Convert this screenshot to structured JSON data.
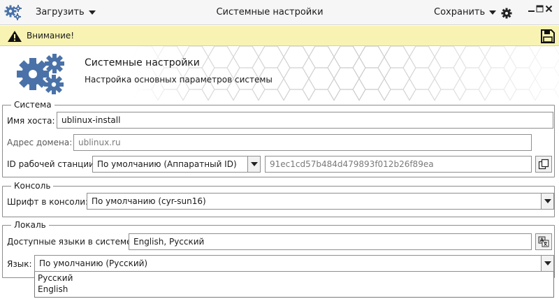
{
  "titlebar": {
    "load_label": "Загрузить",
    "title": "Системные настройки",
    "save_label": "Сохранить"
  },
  "warning": {
    "text": "Внимание!"
  },
  "banner": {
    "title": "Системные настройки",
    "subtitle": "Настройка основных параметров системы"
  },
  "system": {
    "legend": "Система",
    "hostname_label": "Имя хоста:",
    "hostname_value": "ublinux-install",
    "domain_label": "Адрес домена:",
    "domain_placeholder": "ublinux.ru",
    "machine_id_label": "ID рабочей станции:",
    "machine_id_mode": "По умолчанию (Аппаратный ID)",
    "machine_id_value": "91ec1cd57b484d479893f012b26f89ea"
  },
  "console": {
    "legend": "Консоль",
    "font_label": "Шрифт в консоли:",
    "font_value": "По умолчанию (cyr-sun16)"
  },
  "locale": {
    "legend": "Локаль",
    "available_label": "Доступные языки в системе:",
    "available_value": "English, Русский",
    "language_label": "Язык:",
    "language_value": "По умолчанию (Русский)",
    "options": [
      "Русский",
      "English"
    ]
  },
  "colors": {
    "warning_bg": "#f8f3b3",
    "gear_blue": "#4a72a8"
  },
  "icons": {
    "app": "gears-icon",
    "settings": "gear-icon",
    "warning": "warning-triangle-icon",
    "save": "floppy-disk-icon",
    "copy": "copy-icon",
    "translate": "translate-icon"
  }
}
